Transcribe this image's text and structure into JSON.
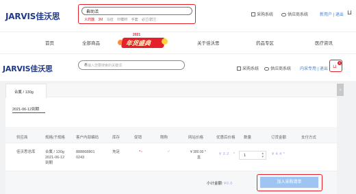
{
  "brand": {
    "name": "JARVIS",
    "name_cn": "佳沃思",
    "accent": "#e4202a",
    "primary": "#1f3a8a"
  },
  "top_search": {
    "value": "自助活",
    "hot_tags": [
      "义药器",
      "3M",
      "马应",
      "印模材",
      "手套",
      "必兰/碧兰"
    ]
  },
  "top_links": {
    "purchase": "采购系统",
    "supplier": "供应商系统",
    "user": "新用户",
    "logout": "退出"
  },
  "nav": {
    "items": [
      "首页",
      "全部商品",
      "关于佳沃思",
      "药品专区",
      "医疗资讯"
    ],
    "promo_label": "年货盛典",
    "promo_year": "2021"
  },
  "header2": {
    "search_placeholder": "请输入您要搜索的关键词",
    "purchase": "采购系统",
    "supplier": "供应商系统",
    "user": "内采专用",
    "logout": "退出",
    "cart_count": "0"
  },
  "product": {
    "tab": "合氟 / 130g",
    "date_label": "2021-06-12到期"
  },
  "table": {
    "headers": [
      "供应商",
      "规格|子规格",
      "客户内部编码",
      "库存",
      "促销",
      "限购",
      "网站价格",
      "优惠后价格",
      "数量",
      "订货金额",
      "支付方式"
    ],
    "row": {
      "supplier": "佳沃思总库",
      "spec_1": "合氟 / 130g",
      "spec_2": "2021-06-12",
      "spec_3": "到期",
      "code_1": "888868801",
      "code_2": "0243",
      "stock": "充足",
      "promo": "*~",
      "limit": "~'",
      "site_price_1": "¥ 380.00 *",
      "site_price_2": "盒",
      "discount_price": "¥ 3.2 . *",
      "quantity": "1",
      "order_amount": "¥ 4.4 *"
    }
  },
  "footer": {
    "subtotal_label": "小计金额:",
    "subtotal_value": "¥0.0",
    "add_button": "加入采购清单"
  }
}
